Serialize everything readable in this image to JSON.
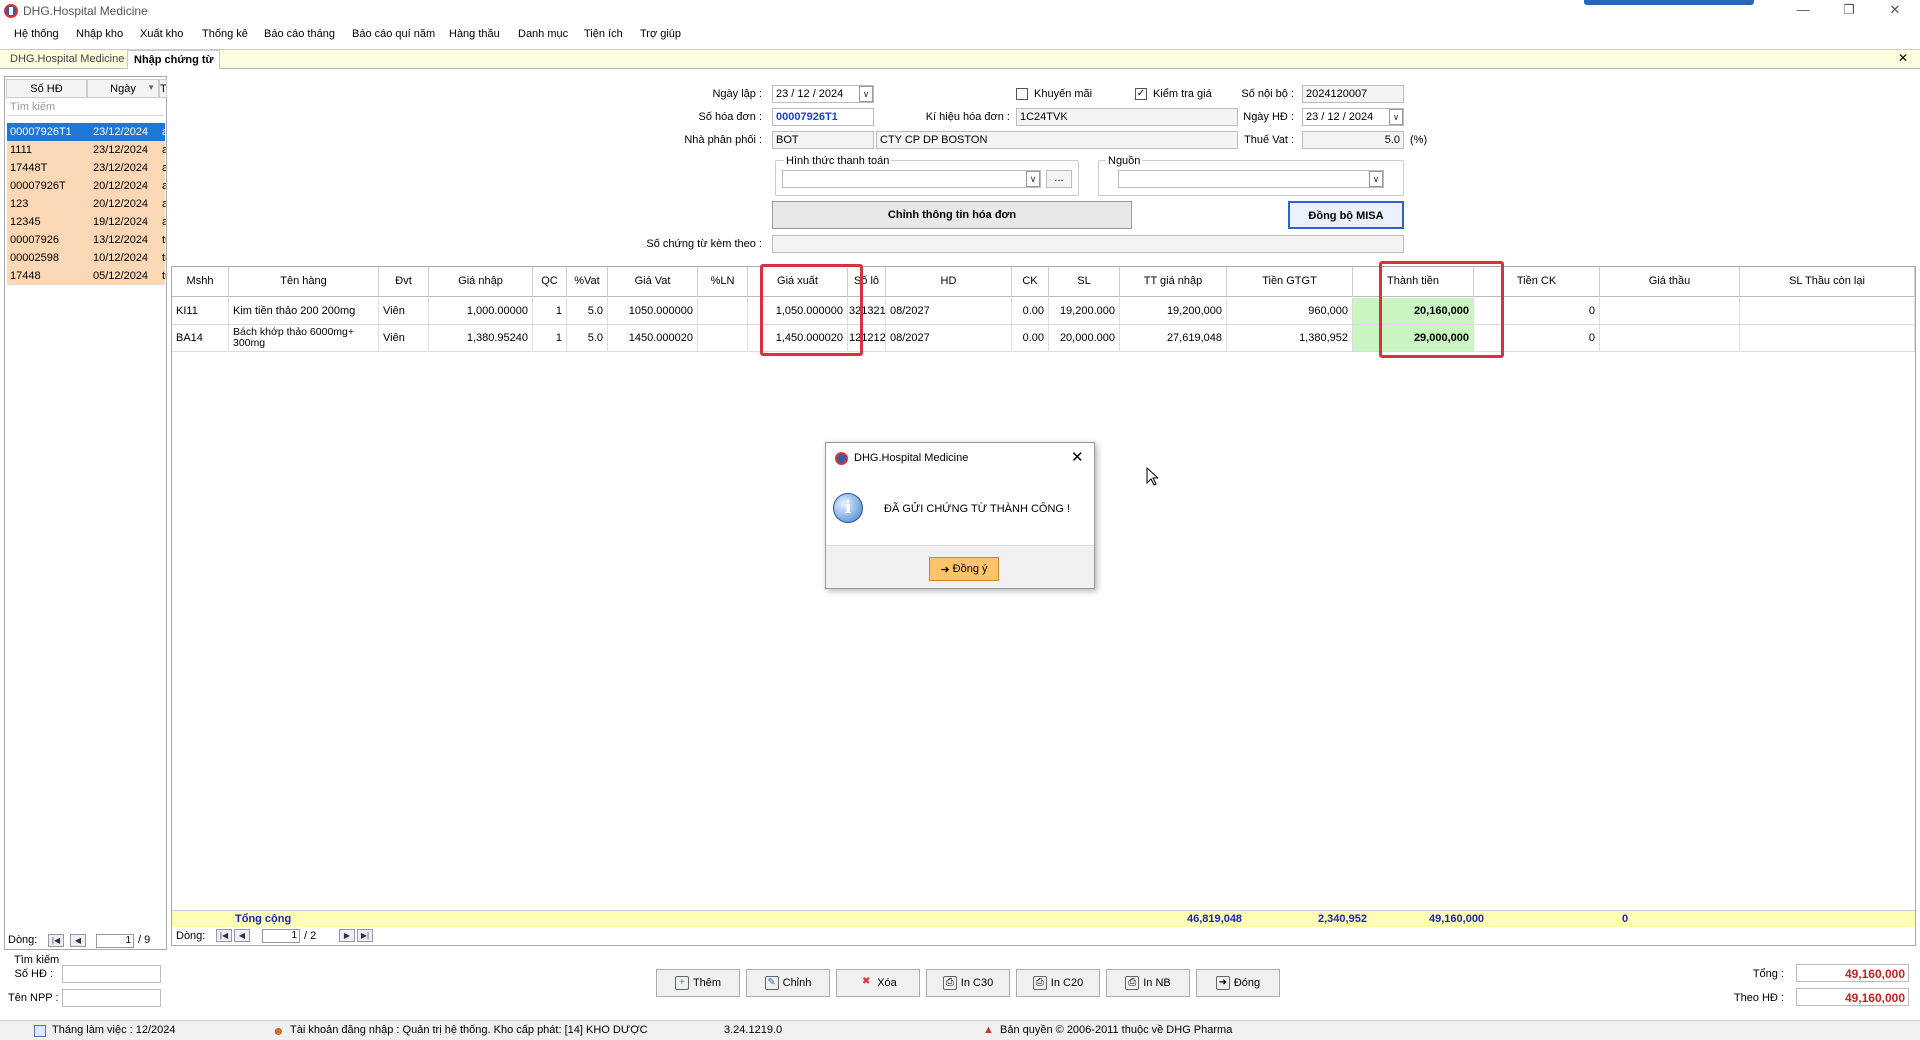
{
  "window": {
    "title": "DHG.Hospital Medicine"
  },
  "menu": [
    "Hệ thống",
    "Nhập kho",
    "Xuất kho",
    "Thống kê",
    "Báo cáo tháng",
    "Báo cáo quí năm",
    "Hàng thầu",
    "Danh mục",
    "Tiện ích",
    "Trợ giúp"
  ],
  "tabs": {
    "tab1": "DHG.Hospital Medicine",
    "tab2": "Nhập chứng từ"
  },
  "left_list": {
    "col_so": "Số HĐ",
    "col_ngay": "Ngày",
    "col_t": "T",
    "search_placeholder": "Tìm kiếm",
    "rows": [
      {
        "so": "00007926T1",
        "ngay": "23/12/2024",
        "t": "a"
      },
      {
        "so": "1111",
        "ngay": "23/12/2024",
        "t": "a"
      },
      {
        "so": "17448T",
        "ngay": "23/12/2024",
        "t": "a"
      },
      {
        "so": "00007926T",
        "ngay": "20/12/2024",
        "t": "a"
      },
      {
        "so": "123",
        "ngay": "20/12/2024",
        "t": "a"
      },
      {
        "so": "12345",
        "ngay": "19/12/2024",
        "t": "a"
      },
      {
        "so": "00007926",
        "ngay": "13/12/2024",
        "t": "tr"
      },
      {
        "so": "00002598",
        "ngay": "10/12/2024",
        "t": "tr"
      },
      {
        "so": "17448",
        "ngay": "05/12/2024",
        "t": "tr"
      }
    ],
    "pager_label": "Dòng:",
    "pager_current": "1",
    "pager_total": "/ 9"
  },
  "form": {
    "ngay_lap_label": "Ngày lập :",
    "ngay_lap": "23 / 12 / 2024",
    "so_hd_label": "Số hóa đơn :",
    "so_hd": "00007926T1",
    "npp_label": "Nhà phân phối :",
    "npp_code": "BOT",
    "npp_name": "CTY CP DP BOSTON",
    "khuyen_mai": "Khuyến mãi",
    "kiem_tra_gia": "Kiểm tra giá",
    "ky_hieu_label": "Kí hiệu hóa đơn :",
    "ky_hieu": "1C24TVK",
    "so_noi_bo_label": "Số nội bộ :",
    "so_noi_bo": "2024120007",
    "ngay_hd_label": "Ngày HĐ :",
    "ngay_hd": "23 / 12 / 2024",
    "thue_vat_label": "Thuế Vat :",
    "thue_vat": "5.0",
    "pct": "(%)",
    "httt_label": "Hình thức thanh toán",
    "nguon_label": "Nguồn",
    "ellipsis": "...",
    "chinh_btn": "Chỉnh thông tin hóa đơn",
    "misa_btn": "Đồng bộ MISA",
    "so_ct_label": "Số chứng từ kèm theo :"
  },
  "grid": {
    "headers": [
      "Mshh",
      "Tên hàng",
      "Đvt",
      "Giá nhập",
      "QC",
      "%Vat",
      "Giá Vat",
      "%LN",
      "Giá xuất",
      "Số lô",
      "HD",
      "CK",
      "SL",
      "TT giá nhập",
      "Tiền GTGT",
      "Thành tiền",
      "Tiền CK",
      "Giá thầu",
      "SL Thầu còn lại"
    ],
    "rows": [
      [
        "KI11",
        "Kim tiền thảo 200 200mg",
        "Viên",
        "1,000.00000",
        "1",
        "5.0",
        "1050.000000",
        "",
        "1,050.000000",
        "321321",
        "08/2027",
        "0.00",
        "19,200.000",
        "19,200,000",
        "960,000",
        "20,160,000",
        "0",
        "",
        ""
      ],
      [
        "BA14",
        "Bách khớp thảo 6000mg+ 300mg",
        "Viên",
        "1,380.95240",
        "1",
        "5.0",
        "1450.000020",
        "",
        "1,450.000020",
        "121212",
        "08/2027",
        "0.00",
        "20,000.000",
        "27,619,048",
        "1,380,952",
        "29,000,000",
        "0",
        "",
        ""
      ]
    ],
    "total_label": "Tổng cộng",
    "total_tt": "46,819,048",
    "total_gtgt": "2,340,952",
    "total_thanh_tien": "49,160,000",
    "total_ck": "0",
    "pager_label": "Dòng:",
    "pager_current": "1",
    "pager_total": "/ 2"
  },
  "bottom": {
    "tim_kiem": "Tìm kiếm",
    "so_hd": "Số HĐ :",
    "ten_npp": "Tên NPP :",
    "buttons": [
      "Thêm",
      "Chỉnh",
      "Xóa",
      "In C30",
      "In C20",
      "In NB",
      "Đóng"
    ],
    "tong_label": "Tổng :",
    "tong": "49,160,000",
    "theo_hd_label": "Theo HĐ :",
    "theo_hd": "49,160,000"
  },
  "status": {
    "thang": "Tháng làm việc : 12/2024",
    "tai_khoan": "Tài khoản đăng nhập : Quản trị hệ thống. Kho cấp phát: [14] KHO DƯỢC",
    "version": "3.24.1219.0",
    "copyright": "Bản quyền © 2006-2011 thuộc về DHG Pharma"
  },
  "dialog": {
    "title": "DHG.Hospital Medicine",
    "message": "ĐÃ GỬI CHỨNG TỪ THÀNH CÔNG !",
    "ok": "Đồng ý"
  }
}
